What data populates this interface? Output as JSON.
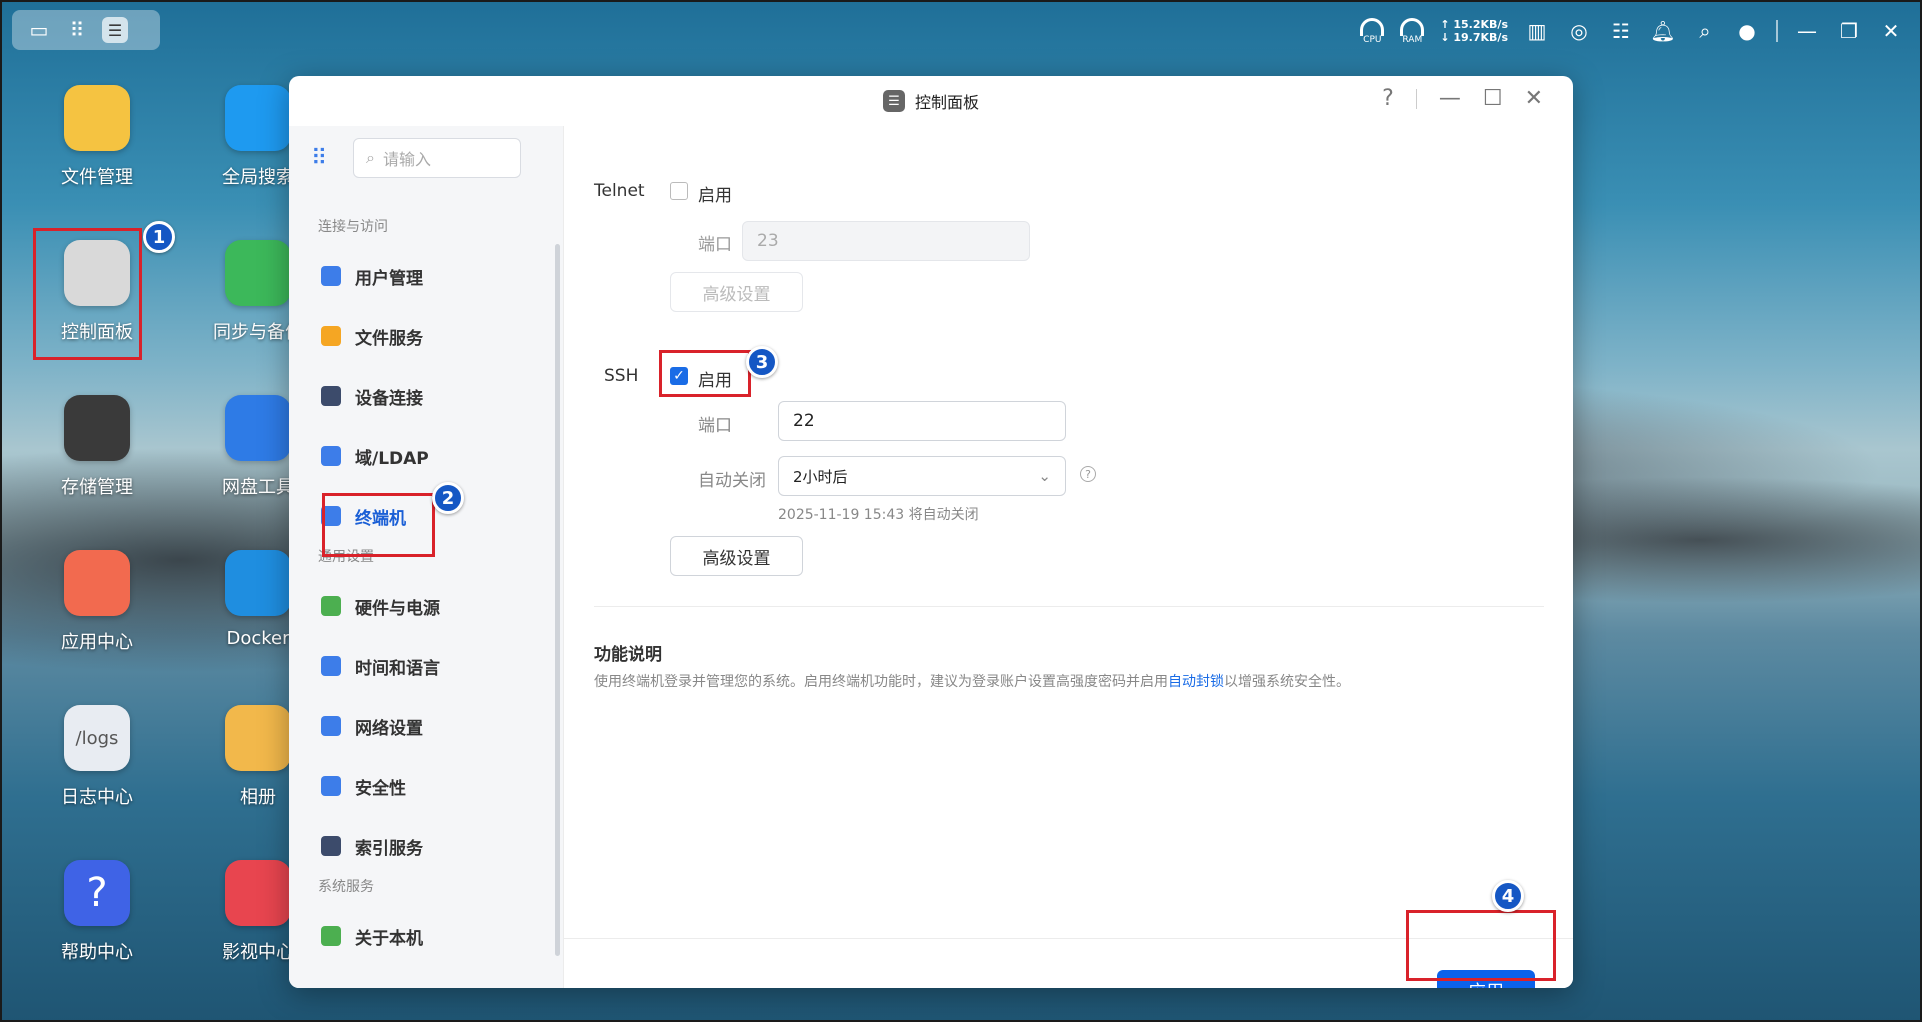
{
  "desktop": {
    "icons": [
      {
        "label": "文件管理",
        "icon": "folder-icon",
        "color": "#f5c341"
      },
      {
        "label": "全局搜索",
        "icon": "search-icon",
        "color": "#1e9af0"
      },
      {
        "label": "控制面板",
        "icon": "sliders-icon",
        "color": "#d9d9d9"
      },
      {
        "label": "同步与备份",
        "icon": "sync-icon",
        "color": "#3cb85a"
      },
      {
        "label": "存储管理",
        "icon": "storage-icon",
        "color": "#3a3a3a"
      },
      {
        "label": "网盘工具",
        "icon": "cloud-drive-icon",
        "color": "#2e7be6"
      },
      {
        "label": "应用中心",
        "icon": "app-center-icon",
        "color": "#f26a4f"
      },
      {
        "label": "Docker",
        "icon": "docker-icon",
        "color": "#1f8ee0"
      },
      {
        "label": "日志中心",
        "icon": "logs-icon",
        "color": "#e8ecf2",
        "text": "/logs"
      },
      {
        "label": "相册",
        "icon": "photo-icon",
        "color": "#f2b84b"
      },
      {
        "label": "帮助中心",
        "icon": "help-icon",
        "color": "#3f63e6",
        "text": "?"
      },
      {
        "label": "影视中心",
        "icon": "video-icon",
        "color": "#e8454f"
      }
    ]
  },
  "topbar": {
    "cpu_label": "CPU",
    "ram_label": "RAM",
    "upload": "15.2KB/s",
    "download": "19.7KB/s"
  },
  "window": {
    "title": "控制面板",
    "help": "?"
  },
  "sidebar": {
    "search_placeholder": "请输入",
    "sections": [
      {
        "title": "连接与访问",
        "items": [
          {
            "label": "用户管理",
            "icon": "user-icon",
            "color": "#3d7de9"
          },
          {
            "label": "文件服务",
            "icon": "folder-icon",
            "color": "#f5a623"
          },
          {
            "label": "设备连接",
            "icon": "device-icon",
            "color": "#3c4b6b"
          },
          {
            "label": "域/LDAP",
            "icon": "ldap-icon",
            "color": "#3d7de9"
          },
          {
            "label": "终端机",
            "icon": "terminal-icon",
            "color": "#3d7de9",
            "active": true
          }
        ]
      },
      {
        "title": "通用设置",
        "items": [
          {
            "label": "硬件与电源",
            "icon": "battery-icon",
            "color": "#4caf50"
          },
          {
            "label": "时间和语言",
            "icon": "globe-icon",
            "color": "#3d7de9"
          },
          {
            "label": "网络设置",
            "icon": "network-icon",
            "color": "#3d7de9"
          },
          {
            "label": "安全性",
            "icon": "shield-icon",
            "color": "#3d7de9"
          },
          {
            "label": "索引服务",
            "icon": "index-icon",
            "color": "#3c4b6b"
          }
        ]
      },
      {
        "title": "系统服务",
        "items": [
          {
            "label": "关于本机",
            "icon": "info-icon",
            "color": "#4caf50"
          }
        ]
      }
    ]
  },
  "telnet": {
    "label": "Telnet",
    "enable": "启用",
    "port_label": "端口",
    "port": "23",
    "advanced": "高级设置"
  },
  "ssh": {
    "label": "SSH",
    "enable": "启用",
    "port_label": "端口",
    "port": "22",
    "auto_close_label": "自动关闭",
    "auto_close_value": "2小时后",
    "auto_close_hint": "2025-11-19 15:43 将自动关闭",
    "advanced": "高级设置"
  },
  "description": {
    "title": "功能说明",
    "text_before": "使用终端机登录并管理您的系统。启用终端机功能时，建议为登录账户设置高强度密码并启用",
    "link": "自动封锁",
    "text_after": "以增强系统安全性。"
  },
  "footer": {
    "apply": "应用"
  },
  "annotations": [
    "1",
    "2",
    "3",
    "4"
  ],
  "colors": {
    "accent": "#0b62ea",
    "highlight": "#d9222a",
    "badge": "#1557c4"
  }
}
